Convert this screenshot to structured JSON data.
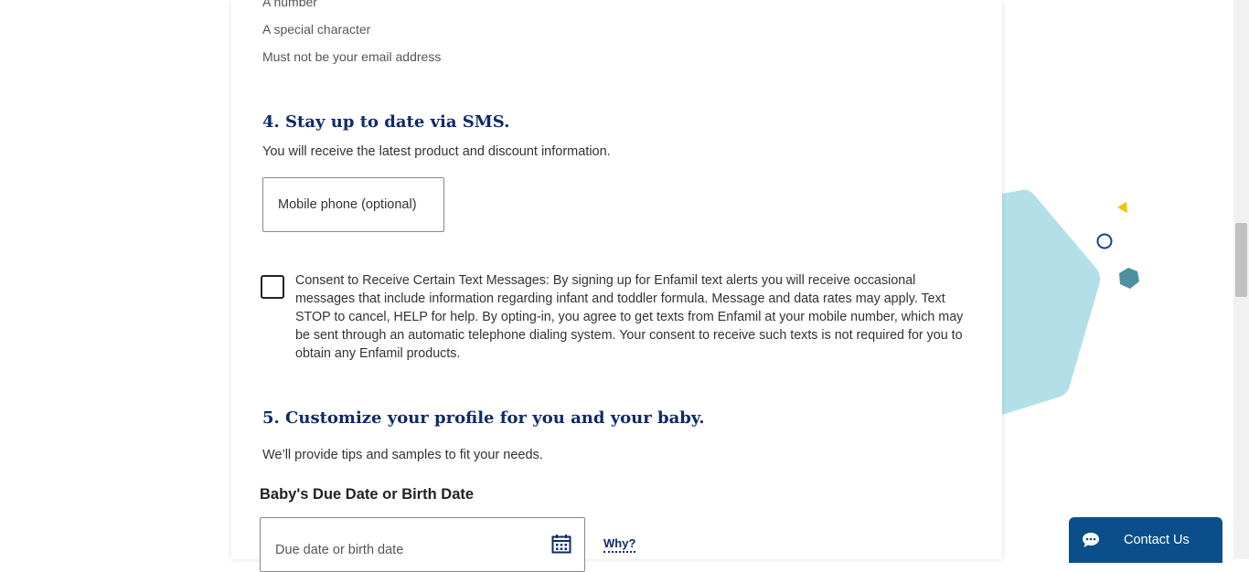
{
  "requirements": [
    "A number",
    "A special character",
    "Must not be your email address"
  ],
  "sms": {
    "heading": "4. Stay up to date via SMS.",
    "description": "You will receive the latest product and discount information.",
    "phone_placeholder": "Mobile phone (optional)",
    "consent_text": "Consent to Receive Certain Text Messages: By signing up for Enfamil text alerts you will receive occasional messages that include information regarding infant and toddler formula. Message and data rates may apply. Text STOP to cancel, HELP for help. By opting-in, you agree to get texts from Enfamil at your mobile number, which may be sent through an automatic telephone dialing system. Your consent to receive such texts is not required for you to obtain any Enfamil products.",
    "consent_checked": false
  },
  "profile": {
    "heading": "5. Customize your profile for you and your baby.",
    "description": "We’ll provide tips and samples to fit your needs.",
    "date_label": "Baby's Due Date or Birth Date",
    "date_placeholder": "Due date or birth date",
    "date_icon": "calendar-icon",
    "why_link": "Why?"
  },
  "contact": {
    "label": "Contact Us",
    "icon": "chat-icon"
  },
  "colors": {
    "heading": "#0f2a6b",
    "contact_bg": "#0b4f8a",
    "deco_pentagon": "#b3e0e8",
    "deco_triangle": "#f2c200",
    "deco_hexagon": "#4f8f9e"
  }
}
